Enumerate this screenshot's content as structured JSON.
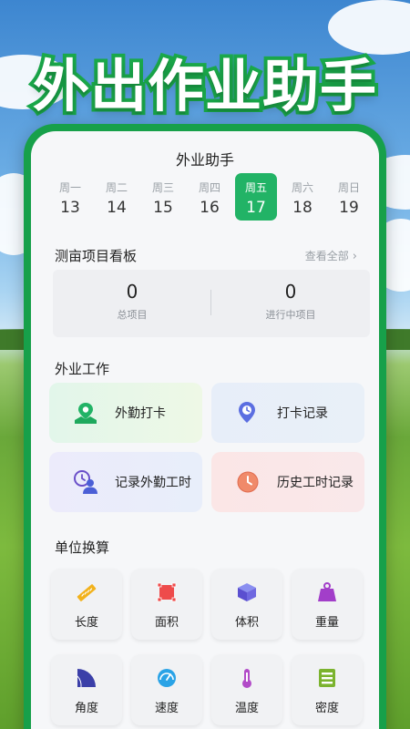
{
  "hero": {
    "title": "外出作业助手"
  },
  "app": {
    "title": "外业助手"
  },
  "week": [
    {
      "name": "周一",
      "date": "13"
    },
    {
      "name": "周二",
      "date": "14"
    },
    {
      "name": "周三",
      "date": "15"
    },
    {
      "name": "周四",
      "date": "16"
    },
    {
      "name": "周五",
      "date": "17"
    },
    {
      "name": "周六",
      "date": "18"
    },
    {
      "name": "周日",
      "date": "19"
    }
  ],
  "board": {
    "title": "测亩项目看板",
    "see_all": "查看全部",
    "total": {
      "value": "0",
      "label": "总项目"
    },
    "active": {
      "value": "0",
      "label": "进行中项目"
    }
  },
  "field_work": {
    "title": "外业工作",
    "items": [
      {
        "label": "外勤打卡",
        "icon": "map-pin-icon"
      },
      {
        "label": "打卡记录",
        "icon": "location-clock-icon"
      },
      {
        "label": "记录外勤工时",
        "icon": "user-clock-icon"
      },
      {
        "label": "历史工时记录",
        "icon": "clock-icon"
      }
    ]
  },
  "units": {
    "title": "单位换算",
    "items": [
      {
        "label": "长度",
        "icon": "ruler-icon"
      },
      {
        "label": "面积",
        "icon": "area-icon"
      },
      {
        "label": "体积",
        "icon": "cube-icon"
      },
      {
        "label": "重量",
        "icon": "weight-icon"
      },
      {
        "label": "角度",
        "icon": "protractor-icon"
      },
      {
        "label": "速度",
        "icon": "speedometer-icon"
      },
      {
        "label": "温度",
        "icon": "thermometer-icon"
      },
      {
        "label": "密度",
        "icon": "density-icon"
      }
    ]
  },
  "colors": {
    "brand": "#22b366",
    "frame": "#17a04a"
  }
}
